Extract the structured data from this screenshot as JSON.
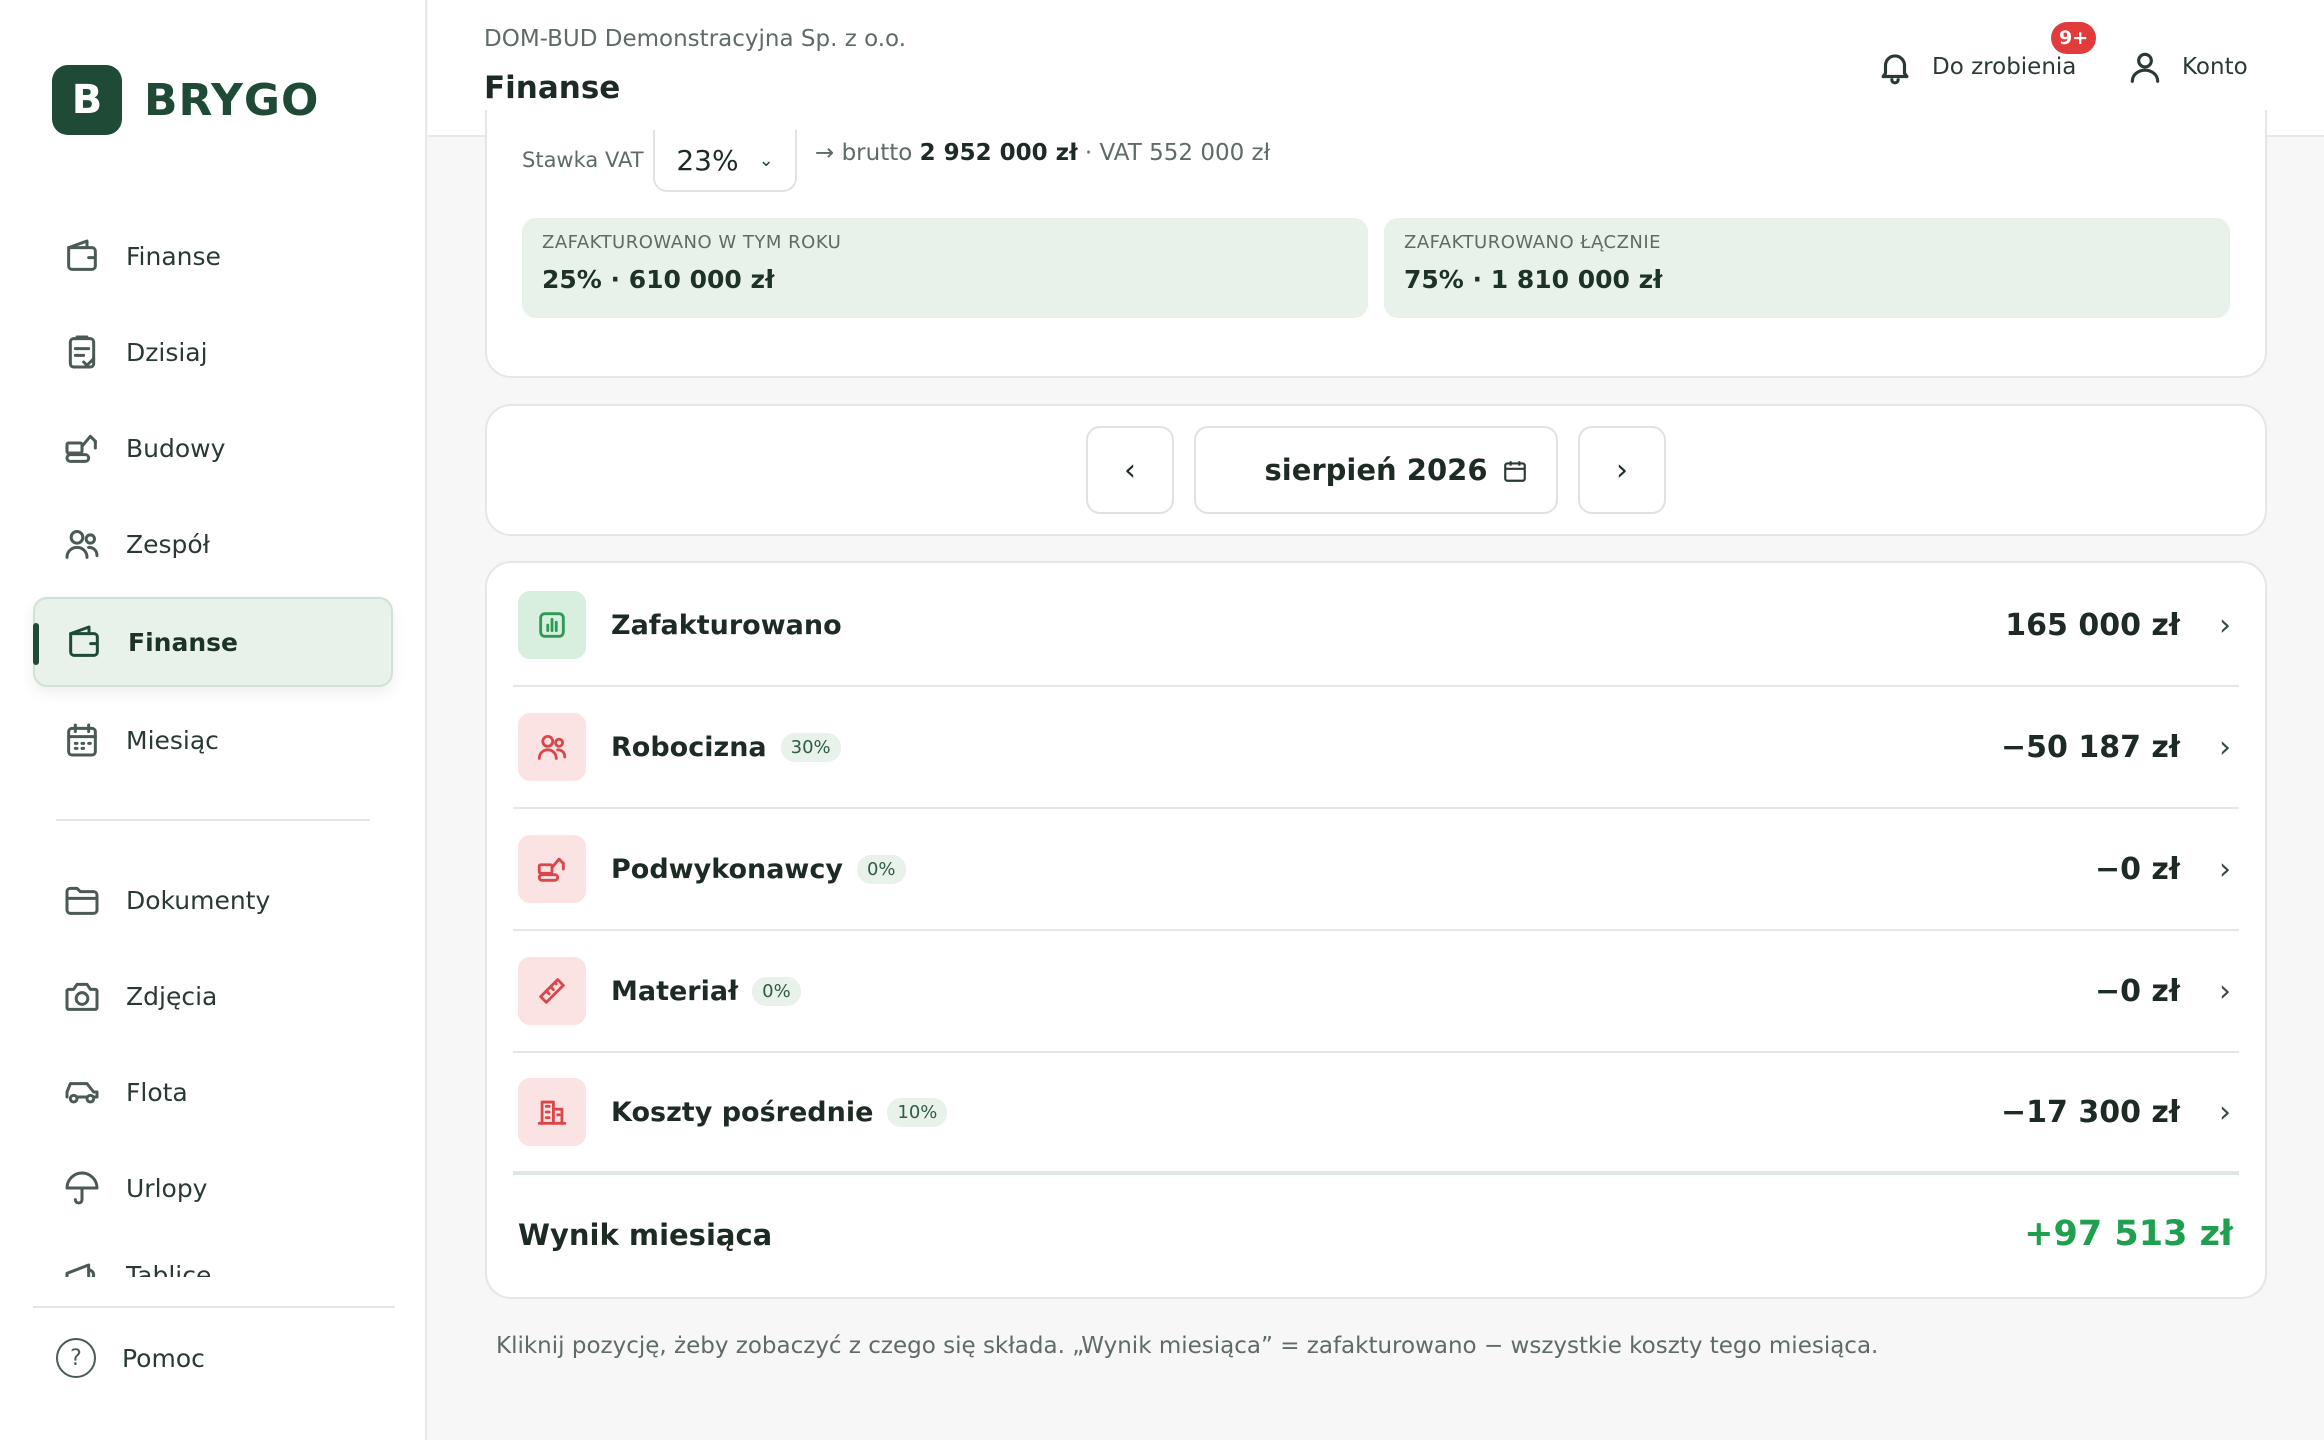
{
  "app": {
    "logo_letter": "B",
    "logo_text": "BRYGO"
  },
  "sidebar": {
    "items": [
      {
        "label": "Finanse",
        "icon": "wallet-icon"
      },
      {
        "label": "Dzisiaj",
        "icon": "clipboard-check-icon"
      },
      {
        "label": "Budowy",
        "icon": "excavator-icon"
      },
      {
        "label": "Zespół",
        "icon": "team-icon"
      },
      {
        "label": "Finanse",
        "icon": "wallet-icon",
        "active": true
      },
      {
        "label": "Miesiąc",
        "icon": "calendar-icon"
      },
      {
        "label": "Dokumenty",
        "icon": "folder-icon"
      },
      {
        "label": "Zdjęcia",
        "icon": "camera-icon"
      },
      {
        "label": "Flota",
        "icon": "car-icon"
      },
      {
        "label": "Urlopy",
        "icon": "umbrella-icon"
      },
      {
        "label": "Tablice",
        "icon": "megaphone-icon"
      }
    ],
    "help_label": "Pomoc"
  },
  "header": {
    "company": "DOM-BUD Demonstracyjna Sp. z o.o.",
    "title": "Finanse",
    "todo_label": "Do zrobienia",
    "todo_badge": "9+",
    "account_label": "Konto"
  },
  "summary": {
    "vat_label": "Stawka VAT",
    "vat_value": "23%",
    "vat_info_prefix": "→ brutto ",
    "vat_info_gross": "2 952 000 zł",
    "vat_info_suffix": " · VAT 552 000 zł",
    "stats": [
      {
        "label": "ZAFAKTUROWANO W TYM ROKU",
        "value": "25% · 610 000 zł"
      },
      {
        "label": "ZAFAKTUROWANO ŁĄCZNIE",
        "value": "75% · 1 810 000 zł"
      }
    ]
  },
  "month": {
    "label": "sierpień 2026",
    "prev": "‹",
    "next": "›"
  },
  "rows": [
    {
      "label": "Zafakturowano",
      "percent": "",
      "amount": "165 000 zł",
      "icon": "chart-icon",
      "tone": "green"
    },
    {
      "label": "Robocizna",
      "percent": "30%",
      "amount": "−50 187 zł",
      "icon": "team-icon",
      "tone": "red"
    },
    {
      "label": "Podwykonawcy",
      "percent": "0%",
      "amount": "−0 zł",
      "icon": "excavator-icon",
      "tone": "red"
    },
    {
      "label": "Materiał",
      "percent": "0%",
      "amount": "−0 zł",
      "icon": "ruler-icon",
      "tone": "red"
    },
    {
      "label": "Koszty pośrednie",
      "percent": "10%",
      "amount": "−17 300 zł",
      "icon": "building-icon",
      "tone": "red"
    }
  ],
  "result": {
    "label": "Wynik miesiąca",
    "value": "+97 513 zł"
  },
  "footnote": "Kliknij pozycję, żeby zobaczyć z czego się składa. „Wynik miesiąca” = zafakturowano − wszystkie koszty tego miesiąca.",
  "colors": {
    "brand": "#1f4a35",
    "positive": "#1fa04f",
    "badge": "#e23b3b",
    "cost_icon": "#d9474a",
    "income_icon": "#2e9b55"
  }
}
